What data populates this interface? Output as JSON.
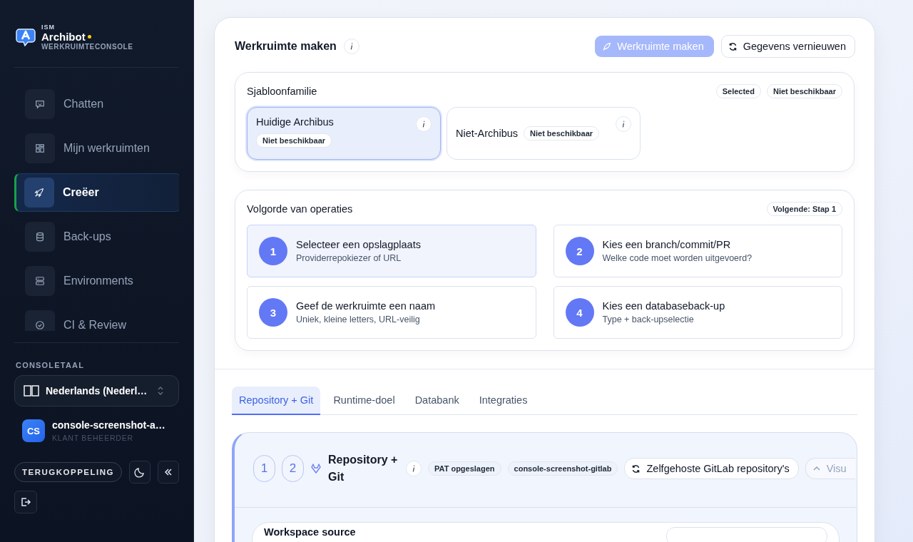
{
  "brand": {
    "org": "ISM",
    "name": "Archibot",
    "subtitle": "WERKRUIMTECONSOLE"
  },
  "nav": [
    {
      "label": "Chatten",
      "kind": "chat",
      "selected": false
    },
    {
      "label": "Mijn werkruimten",
      "kind": "grid",
      "selected": false
    },
    {
      "label": "Creëer",
      "kind": "rocket",
      "selected": true
    },
    {
      "label": "Back-ups",
      "kind": "database",
      "selected": false
    },
    {
      "label": "Environments",
      "kind": "server",
      "selected": false
    },
    {
      "label": "CI & Review",
      "kind": "check",
      "selected": false
    }
  ],
  "language": {
    "label": "CONSOLETAAL",
    "value": "Nederlands (Nederl…"
  },
  "user": {
    "initials": "CS",
    "name": "console-screenshot-a…",
    "role": "KLANT BEHEERDER"
  },
  "feedback": "TERUGKOPPELING",
  "header": {
    "title": "Werkruimte maken",
    "primary": {
      "label": "Werkruimte maken",
      "disabled": true
    },
    "refresh": "Gegevens vernieuwen"
  },
  "template_family": {
    "title": "Sjabloonfamilie",
    "badges": [
      "Selected",
      "Niet beschikbaar"
    ],
    "options": [
      {
        "name": "Huidige Archibus",
        "badge": "Niet beschikbaar",
        "selected": true
      },
      {
        "name": "Niet-Archibus",
        "badge": "Niet beschikbaar",
        "selected": false
      }
    ]
  },
  "operations": {
    "title": "Volgorde van operaties",
    "badge": "Volgende: Stap 1",
    "steps": [
      {
        "number": "1",
        "title": "Selecteer een opslagplaats",
        "subtitle": "Providerrepokiezer of URL",
        "selected": true
      },
      {
        "number": "2",
        "title": "Kies een branch/commit/PR",
        "subtitle": "Welke code moet worden uitgevoerd?",
        "selected": false
      },
      {
        "number": "3",
        "title": "Geef de werkruimte een naam",
        "subtitle": "Uniek, kleine letters, URL-veilig",
        "selected": false
      },
      {
        "number": "4",
        "title": "Kies een databaseback-up",
        "subtitle": "Type + back-upselectie",
        "selected": false
      }
    ]
  },
  "tabs": [
    {
      "label": "Repository + Git",
      "selected": true
    },
    {
      "label": "Runtime-doel",
      "selected": false
    },
    {
      "label": "Databank",
      "selected": false
    },
    {
      "label": "Integraties",
      "selected": false
    }
  ],
  "repository": {
    "steps": [
      "1",
      "2"
    ],
    "title": "Repository + Git",
    "badges": [
      "PAT opgeslagen",
      "console-screenshot-gitlab"
    ],
    "refresh": "Zelfgehoste GitLab repository's",
    "collapse": "Visu",
    "source": {
      "title": "Workspace source"
    }
  }
}
